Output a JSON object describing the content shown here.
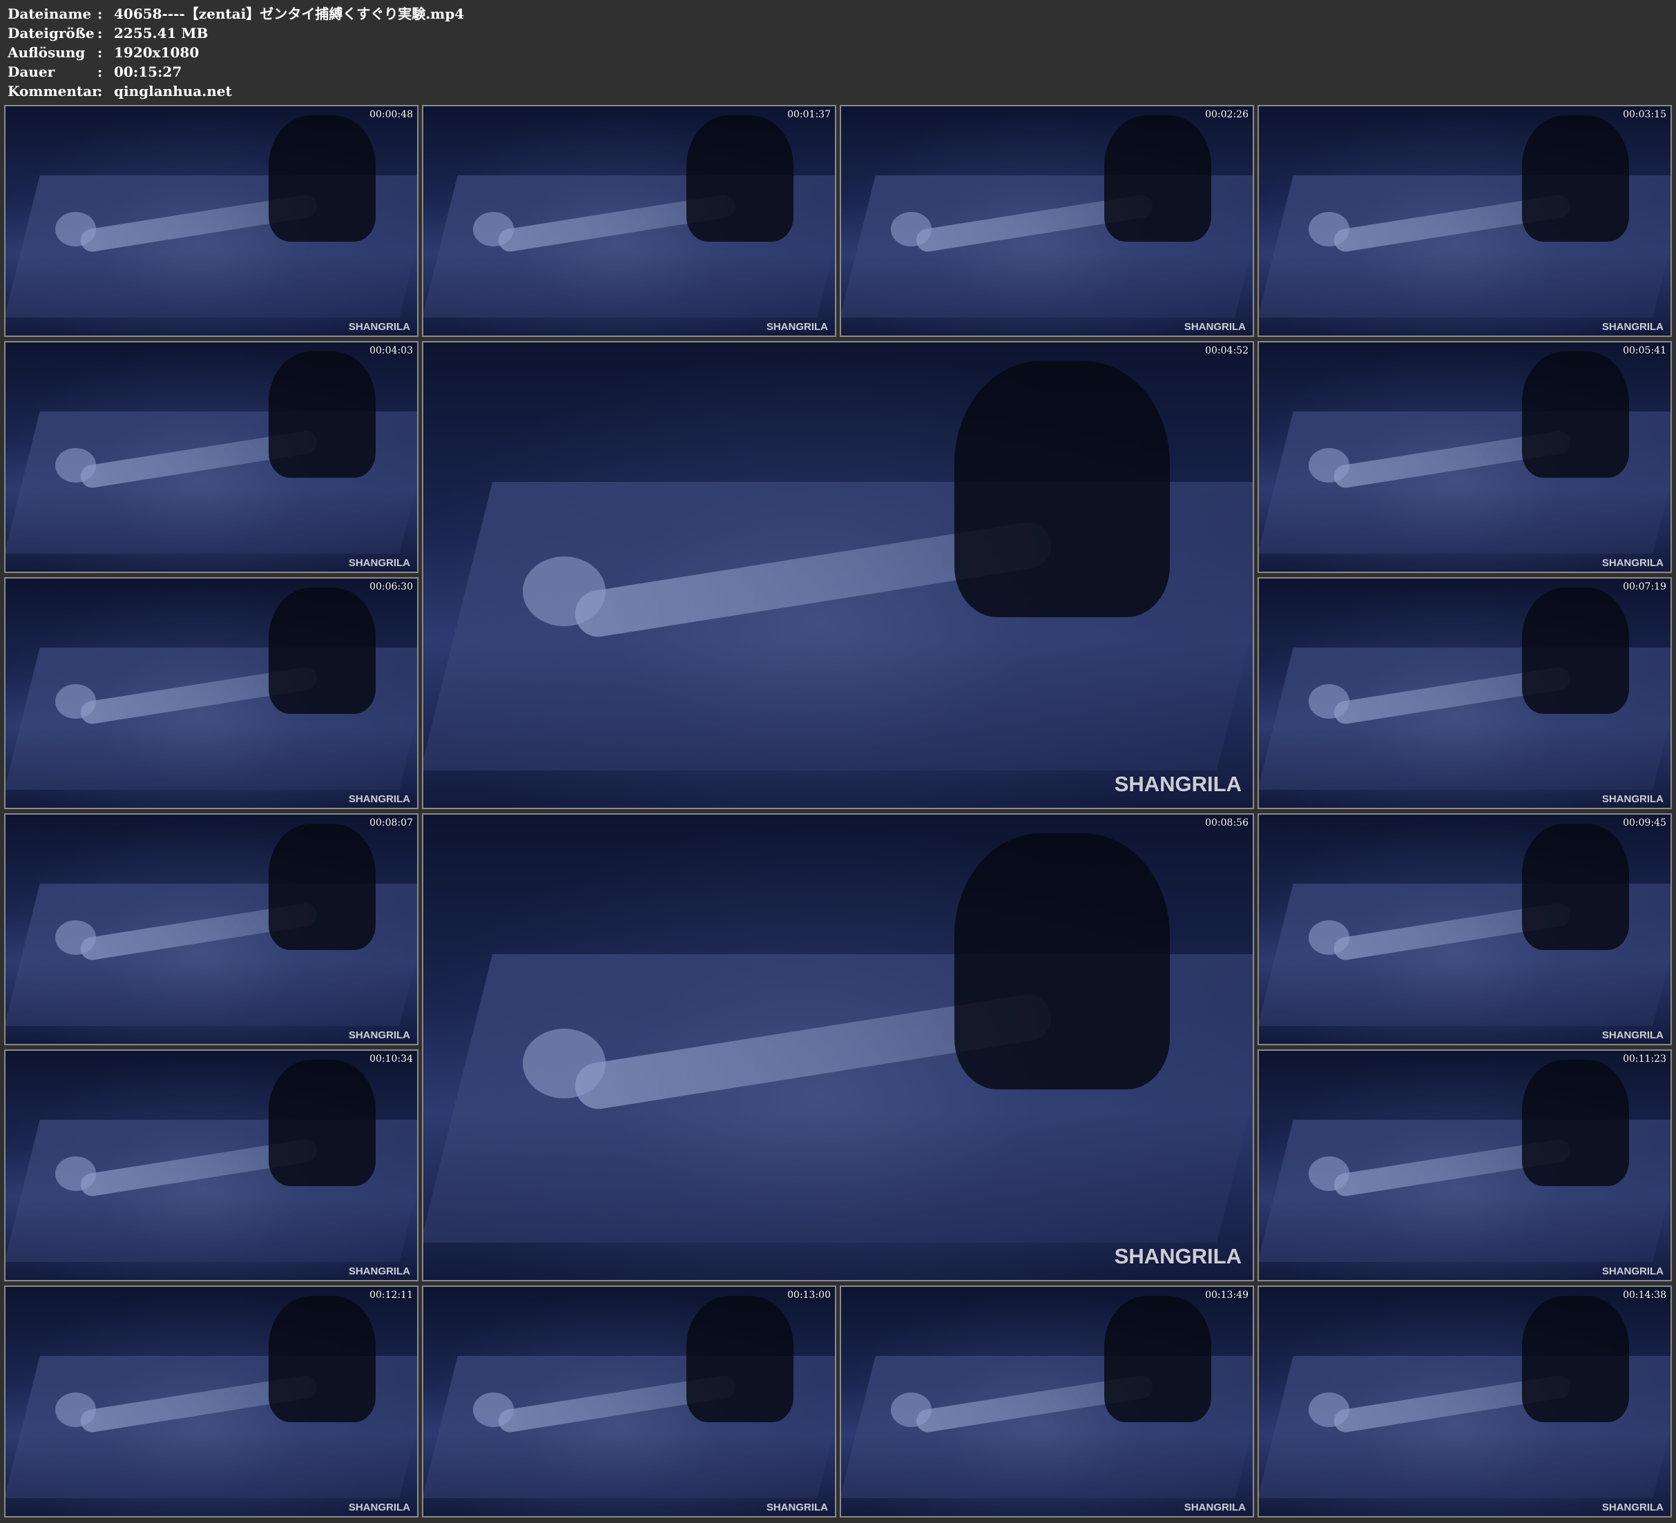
{
  "info": [
    {
      "label": "Dateiname",
      "sep": ":",
      "value": "40658----【zentai】ゼンタイ捕縛くすぐり実験.mp4"
    },
    {
      "label": "Dateigröße",
      "sep": ":",
      "value": "2255.41 MB"
    },
    {
      "label": "Auflösung",
      "sep": ":",
      "value": "1920x1080"
    },
    {
      "label": "Dauer",
      "sep": ":",
      "value": "00:15:27"
    },
    {
      "label": "Kommentar",
      "sep": ":",
      "value": "qinglanhua.net"
    }
  ],
  "watermark": "SHANGRILA",
  "thumbnails": [
    {
      "time": "00:00:48"
    },
    {
      "time": "00:01:37"
    },
    {
      "time": "00:02:26"
    },
    {
      "time": "00:03:15"
    },
    {
      "time": "00:04:03"
    },
    {
      "time": "00:04:52"
    },
    {
      "time": "00:05:41"
    },
    {
      "time": "00:06:30"
    },
    {
      "time": "00:07:19"
    },
    {
      "time": "00:08:07"
    },
    {
      "time": "00:08:56"
    },
    {
      "time": "00:09:45"
    },
    {
      "time": "00:10:34"
    },
    {
      "time": "00:11:23"
    },
    {
      "time": "00:12:11"
    },
    {
      "time": "00:13:00"
    },
    {
      "time": "00:13:49"
    },
    {
      "time": "00:14:38"
    }
  ]
}
